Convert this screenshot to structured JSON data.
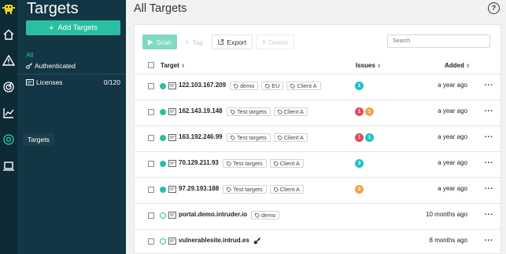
{
  "sidebar": {
    "title": "Targets",
    "add_button": "Add Targets",
    "nav_all": "All",
    "nav_authenticated": "Authenticated",
    "nav_licenses": "Licenses",
    "licenses_count": "0/120",
    "tooltip": "Targets"
  },
  "main": {
    "title": "All Targets",
    "help": "?"
  },
  "toolbar": {
    "scan": "Scan",
    "tag": "Tag",
    "export": "Export",
    "delete": "Delete",
    "search_placeholder": "Search"
  },
  "table": {
    "headers": {
      "target": "Target",
      "issues": "Issues",
      "added": "Added"
    },
    "rows": [
      {
        "host": "122.103.167.209",
        "tags": [
          "demo",
          "EU",
          "Client A"
        ],
        "issues": [
          {
            "n": "1",
            "c": "#1fc1c9"
          }
        ],
        "added": "a year ago",
        "status": "filled"
      },
      {
        "host": "162.143.19.148",
        "tags": [
          "Test targets",
          "Client A"
        ],
        "issues": [
          {
            "n": "1",
            "c": "#e24b5a"
          },
          {
            "n": "1",
            "c": "#f0a542"
          }
        ],
        "added": "a year ago",
        "status": "filled"
      },
      {
        "host": "163.192.246.99",
        "tags": [
          "Test targets",
          "Client A"
        ],
        "issues": [
          {
            "n": "1",
            "c": "#e24b5a"
          },
          {
            "n": "1",
            "c": "#1fc1c9"
          }
        ],
        "added": "a year ago",
        "status": "filled"
      },
      {
        "host": "70.129.211.93",
        "tags": [
          "Test targets",
          "Client A"
        ],
        "issues": [
          {
            "n": "3",
            "c": "#1fc1c9"
          }
        ],
        "added": "a year ago",
        "status": "filled"
      },
      {
        "host": "97.29.193.188",
        "tags": [
          "Test targets",
          "Client A"
        ],
        "issues": [
          {
            "n": "2",
            "c": "#f0a542"
          }
        ],
        "added": "a year ago",
        "status": "filled"
      },
      {
        "host": "portal.demo.intruder.io",
        "tags": [
          "demo"
        ],
        "issues": [],
        "added": "10 months ago",
        "status": "hollow"
      },
      {
        "host": "vulnerablesite.intrud.es",
        "tags": [],
        "issues": [],
        "added": "8 months ago",
        "status": "hollow",
        "key_icon": "key-icon"
      }
    ]
  },
  "colors": {
    "accent": "#2bbfa2",
    "sidebar_bg": "#123643",
    "rail_bg": "#0e2a35"
  }
}
